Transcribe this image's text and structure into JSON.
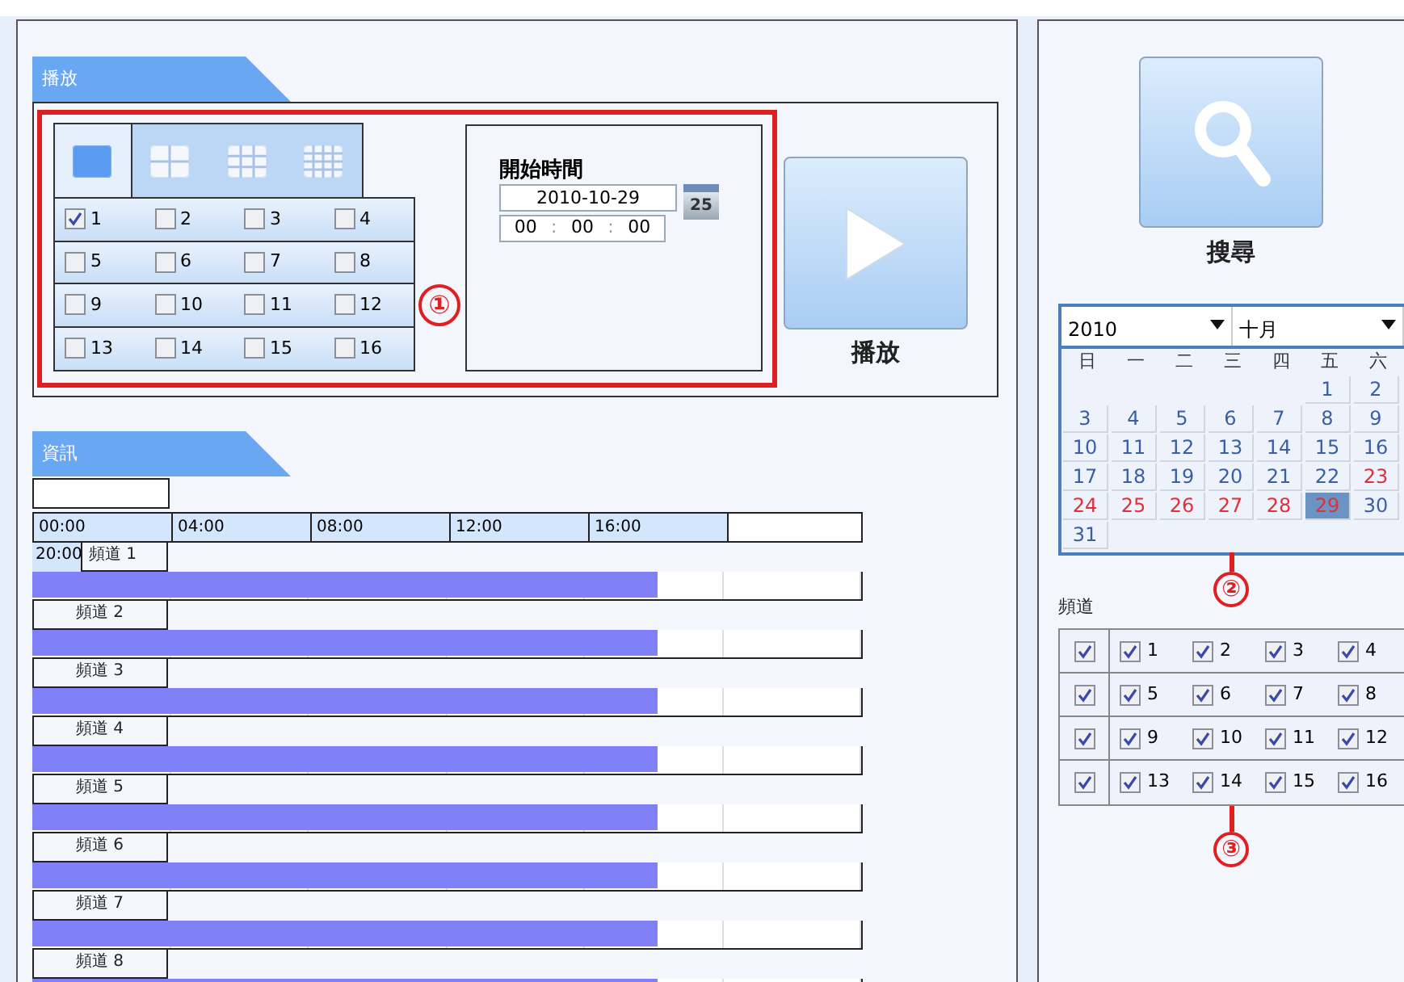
{
  "playback": {
    "title": "播放",
    "callout": "①",
    "layout_tabs": [
      {
        "kind": "single",
        "selected": true
      },
      {
        "kind": "quad",
        "selected": false
      },
      {
        "kind": "nine",
        "selected": false
      },
      {
        "kind": "sixteen",
        "selected": false
      }
    ],
    "channels": [
      {
        "label": "1",
        "checked": true
      },
      {
        "label": "2",
        "checked": false
      },
      {
        "label": "3",
        "checked": false
      },
      {
        "label": "4",
        "checked": false
      },
      {
        "label": "5",
        "checked": false
      },
      {
        "label": "6",
        "checked": false
      },
      {
        "label": "7",
        "checked": false
      },
      {
        "label": "8",
        "checked": false
      },
      {
        "label": "9",
        "checked": false
      },
      {
        "label": "10",
        "checked": false
      },
      {
        "label": "11",
        "checked": false
      },
      {
        "label": "12",
        "checked": false
      },
      {
        "label": "13",
        "checked": false
      },
      {
        "label": "14",
        "checked": false
      },
      {
        "label": "15",
        "checked": false
      },
      {
        "label": "16",
        "checked": false
      }
    ],
    "start_time": {
      "label": "開始時間",
      "date": "2010-10-29",
      "calendar_button": "25",
      "hour": "00",
      "minute": "00",
      "second": "00",
      "separator": ":"
    },
    "play_button": {
      "label": "播放"
    }
  },
  "info": {
    "title": "資訊",
    "hours": [
      "00:00",
      "04:00",
      "08:00",
      "12:00",
      "16:00"
    ],
    "wrapped_hour": "20:00",
    "channels": [
      {
        "name": "頻道 1",
        "level": 0.755
      },
      {
        "name": "頻道 2",
        "level": 0.755
      },
      {
        "name": "頻道 3",
        "level": 0.755
      },
      {
        "name": "頻道 4",
        "level": 0.755
      },
      {
        "name": "頻道 5",
        "level": 0.755
      },
      {
        "name": "頻道 6",
        "level": 0.755
      },
      {
        "name": "頻道 7",
        "level": 0.755
      },
      {
        "name": "頻道 8",
        "level": 0.755
      }
    ]
  },
  "search": {
    "button_label": "搜尋",
    "calendar": {
      "year": "2010",
      "month": "十月",
      "weekdays": [
        "日",
        "一",
        "二",
        "三",
        "四",
        "五",
        "六"
      ],
      "weeks": [
        {
          "kind": "first",
          "days": [
            {
              "day": "1",
              "kind": "normal",
              "selected": false
            },
            {
              "day": "2",
              "kind": "normal",
              "selected": false
            }
          ]
        },
        {
          "kind": "full",
          "days": [
            {
              "day": "3",
              "kind": "normal",
              "selected": false
            },
            {
              "day": "4",
              "kind": "normal",
              "selected": false
            },
            {
              "day": "5",
              "kind": "normal",
              "selected": false
            },
            {
              "day": "6",
              "kind": "normal",
              "selected": false
            },
            {
              "day": "7",
              "kind": "normal",
              "selected": false
            },
            {
              "day": "8",
              "kind": "normal",
              "selected": false
            },
            {
              "day": "9",
              "kind": "normal",
              "selected": false
            }
          ]
        },
        {
          "kind": "full",
          "days": [
            {
              "day": "10",
              "kind": "normal",
              "selected": false
            },
            {
              "day": "11",
              "kind": "normal",
              "selected": false
            },
            {
              "day": "12",
              "kind": "normal",
              "selected": false
            },
            {
              "day": "13",
              "kind": "normal",
              "selected": false
            },
            {
              "day": "14",
              "kind": "normal",
              "selected": false
            },
            {
              "day": "15",
              "kind": "normal",
              "selected": false
            },
            {
              "day": "16",
              "kind": "normal",
              "selected": false
            }
          ]
        },
        {
          "kind": "full",
          "days": [
            {
              "day": "17",
              "kind": "normal",
              "selected": false
            },
            {
              "day": "18",
              "kind": "normal",
              "selected": false
            },
            {
              "day": "19",
              "kind": "normal",
              "selected": false
            },
            {
              "day": "20",
              "kind": "normal",
              "selected": false
            },
            {
              "day": "21",
              "kind": "normal",
              "selected": false
            },
            {
              "day": "22",
              "kind": "normal",
              "selected": false
            },
            {
              "day": "23",
              "kind": "recorded",
              "selected": false
            }
          ]
        },
        {
          "kind": "full",
          "days": [
            {
              "day": "24",
              "kind": "recorded",
              "selected": false
            },
            {
              "day": "25",
              "kind": "recorded",
              "selected": false
            },
            {
              "day": "26",
              "kind": "recorded",
              "selected": false
            },
            {
              "day": "27",
              "kind": "recorded",
              "selected": false
            },
            {
              "day": "28",
              "kind": "recorded",
              "selected": false
            },
            {
              "day": "29",
              "kind": "recorded",
              "selected": true
            },
            {
              "day": "30",
              "kind": "normal",
              "selected": false
            }
          ]
        },
        {
          "kind": "last",
          "days": [
            {
              "day": "31",
              "kind": "normal",
              "selected": false
            }
          ]
        }
      ]
    },
    "calendar_callout": "②",
    "channel_filter": {
      "label": "頻道",
      "callout": "③",
      "rows": [
        {
          "checked": true,
          "channels": [
            {
              "label": "1",
              "checked": true
            },
            {
              "label": "2",
              "checked": true
            },
            {
              "label": "3",
              "checked": true
            },
            {
              "label": "4",
              "checked": true
            }
          ]
        },
        {
          "checked": true,
          "channels": [
            {
              "label": "5",
              "checked": true
            },
            {
              "label": "6",
              "checked": true
            },
            {
              "label": "7",
              "checked": true
            },
            {
              "label": "8",
              "checked": true
            }
          ]
        },
        {
          "checked": true,
          "channels": [
            {
              "label": "9",
              "checked": true
            },
            {
              "label": "10",
              "checked": true
            },
            {
              "label": "11",
              "checked": true
            },
            {
              "label": "12",
              "checked": true
            }
          ]
        },
        {
          "checked": true,
          "channels": [
            {
              "label": "13",
              "checked": true
            },
            {
              "label": "14",
              "checked": true
            },
            {
              "label": "15",
              "checked": true
            },
            {
              "label": "16",
              "checked": true
            }
          ]
        }
      ]
    }
  }
}
